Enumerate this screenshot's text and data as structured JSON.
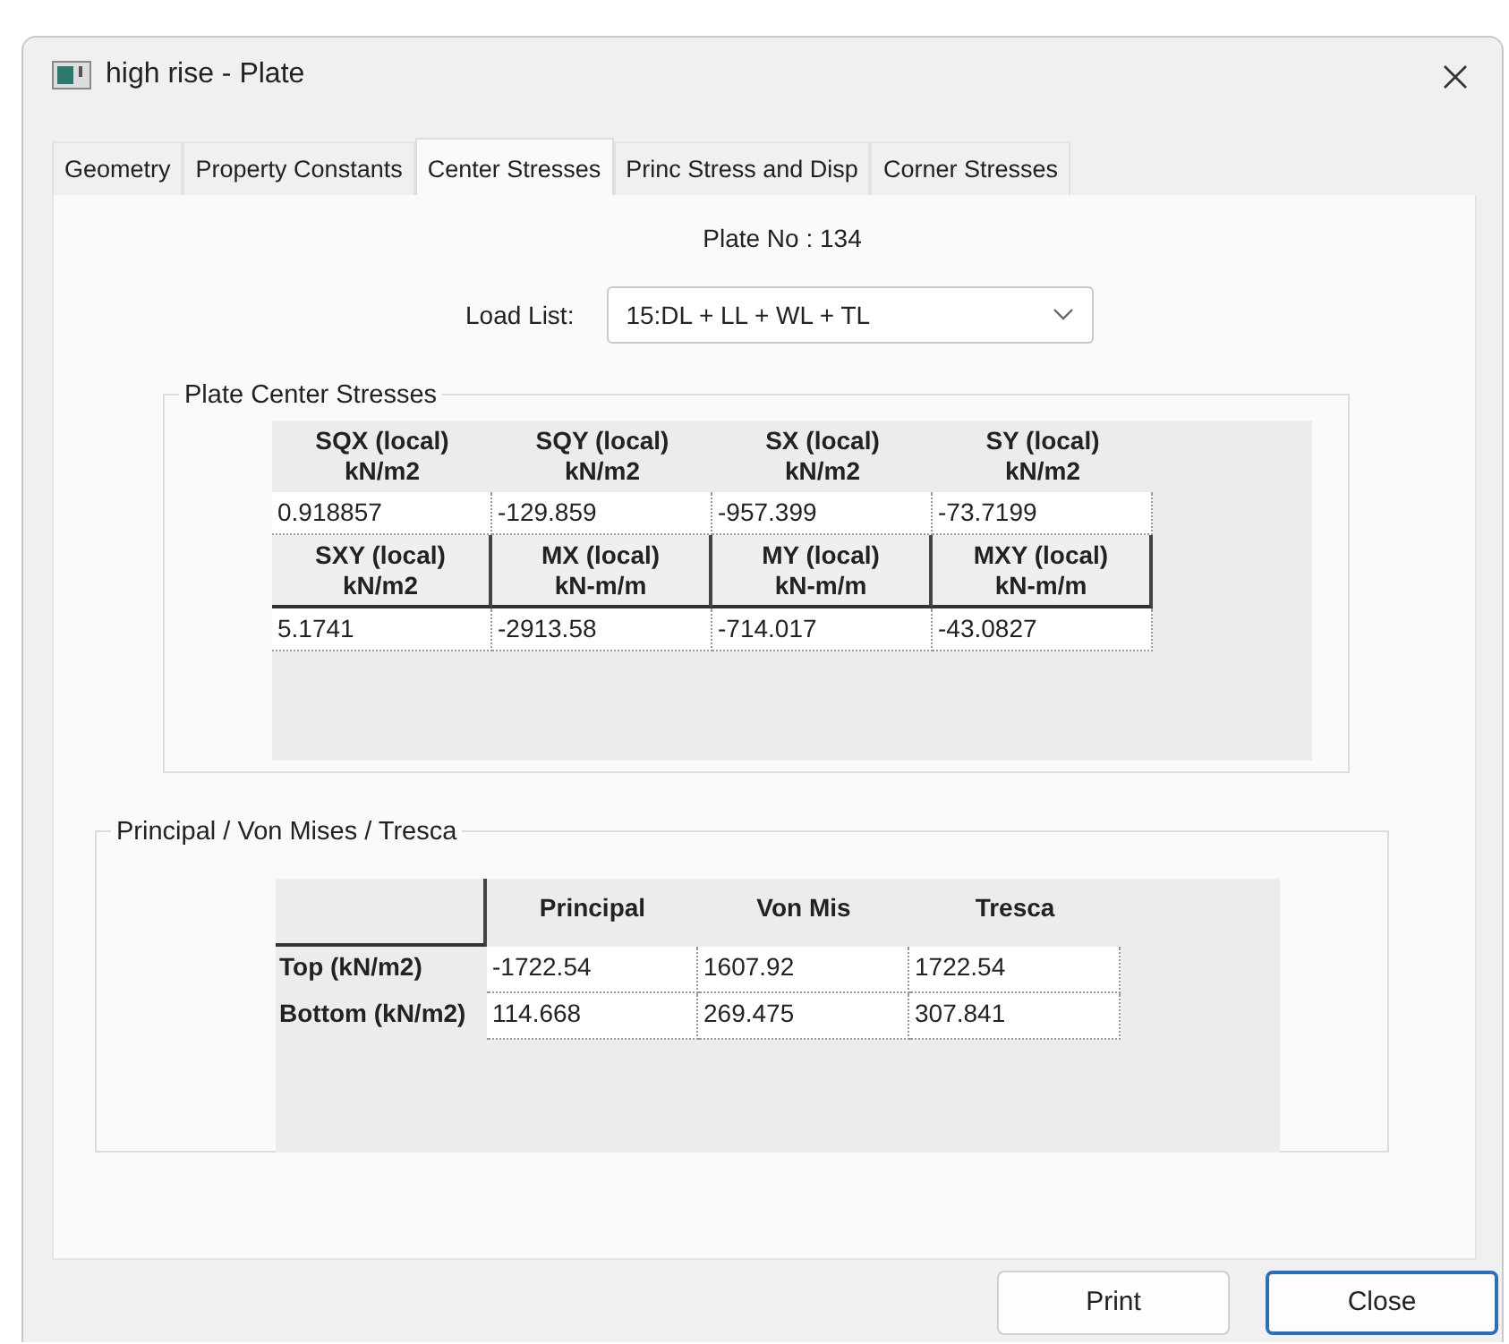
{
  "window": {
    "title": "high rise - Plate"
  },
  "tabs": [
    {
      "label": "Geometry",
      "selected": false
    },
    {
      "label": "Property  Constants",
      "selected": false
    },
    {
      "label": "Center Stresses",
      "selected": true
    },
    {
      "label": "Princ Stress and Disp",
      "selected": false
    },
    {
      "label": "Corner Stresses",
      "selected": false
    }
  ],
  "plate_no": "Plate No : 134",
  "load_list": {
    "label": "Load List:",
    "value": "15:DL + LL + WL + TL"
  },
  "center_stresses": {
    "title": "Plate Center Stresses",
    "blocks": [
      {
        "headers": [
          {
            "name": "SQX (local)",
            "unit": "kN/m2"
          },
          {
            "name": "SQY (local)",
            "unit": "kN/m2"
          },
          {
            "name": "SX (local)",
            "unit": "kN/m2"
          },
          {
            "name": "SY (local)",
            "unit": "kN/m2"
          }
        ],
        "values": [
          "0.918857",
          "-129.859",
          "-957.399",
          "-73.7199"
        ]
      },
      {
        "headers": [
          {
            "name": "SXY (local)",
            "unit": "kN/m2"
          },
          {
            "name": "MX (local)",
            "unit": "kN-m/m"
          },
          {
            "name": "MY (local)",
            "unit": "kN-m/m"
          },
          {
            "name": "MXY (local)",
            "unit": "kN-m/m"
          }
        ],
        "values": [
          "5.1741",
          "-2913.58",
          "-714.017",
          "-43.0827"
        ]
      }
    ]
  },
  "principal": {
    "title": "Principal / Von Mises / Tresca",
    "columns": [
      "Principal",
      "Von Mis",
      "Tresca"
    ],
    "rows": [
      {
        "label": "Top (kN/m2)",
        "values": [
          "-1722.54",
          "1607.92",
          "1722.54"
        ]
      },
      {
        "label": "Bottom (kN/m2)",
        "values": [
          "114.668",
          "269.475",
          "307.841"
        ]
      }
    ]
  },
  "buttons": [
    {
      "label": "Print",
      "focused": false
    },
    {
      "label": "Close",
      "focused": true
    }
  ]
}
